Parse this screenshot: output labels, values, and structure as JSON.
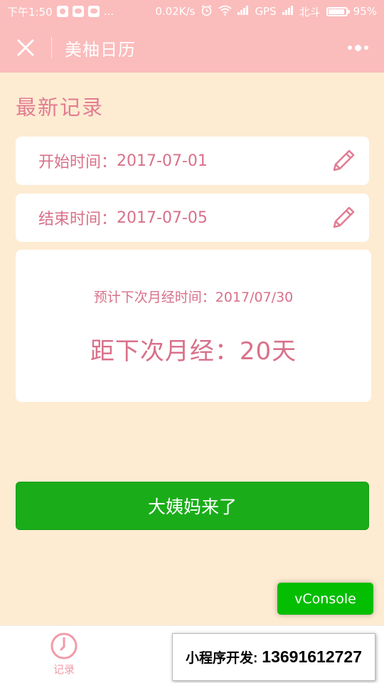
{
  "status_bar": {
    "time": "下午1:50",
    "more": "...",
    "net_speed": "0.02K/s",
    "gps": "GPS",
    "carrier": "北斗",
    "battery": "95%"
  },
  "nav": {
    "title": "美柚日历"
  },
  "section_title": "最新记录",
  "start_record": {
    "label": "开始时间：",
    "value": "2017-07-01"
  },
  "end_record": {
    "label": "结束时间：",
    "value": "2017-07-05"
  },
  "prediction": {
    "label": "预计下次月经时间：",
    "date": "2017/07/30",
    "countdown_label": "距下次月经：",
    "countdown_value": "20天"
  },
  "main_button": "大姨妈来了",
  "vconsole": "vConsole",
  "tab_bar": {
    "items": [
      {
        "label": "记录",
        "icon": "clock-icon"
      }
    ]
  },
  "watermark": {
    "label": "小程序开发:",
    "number": "13691612727"
  },
  "colors": {
    "header": "#fbbcbc",
    "background": "#fdecd2",
    "accent_pink": "#d9708a",
    "button_green": "#1aad19",
    "vconsole_green": "#04be02"
  }
}
